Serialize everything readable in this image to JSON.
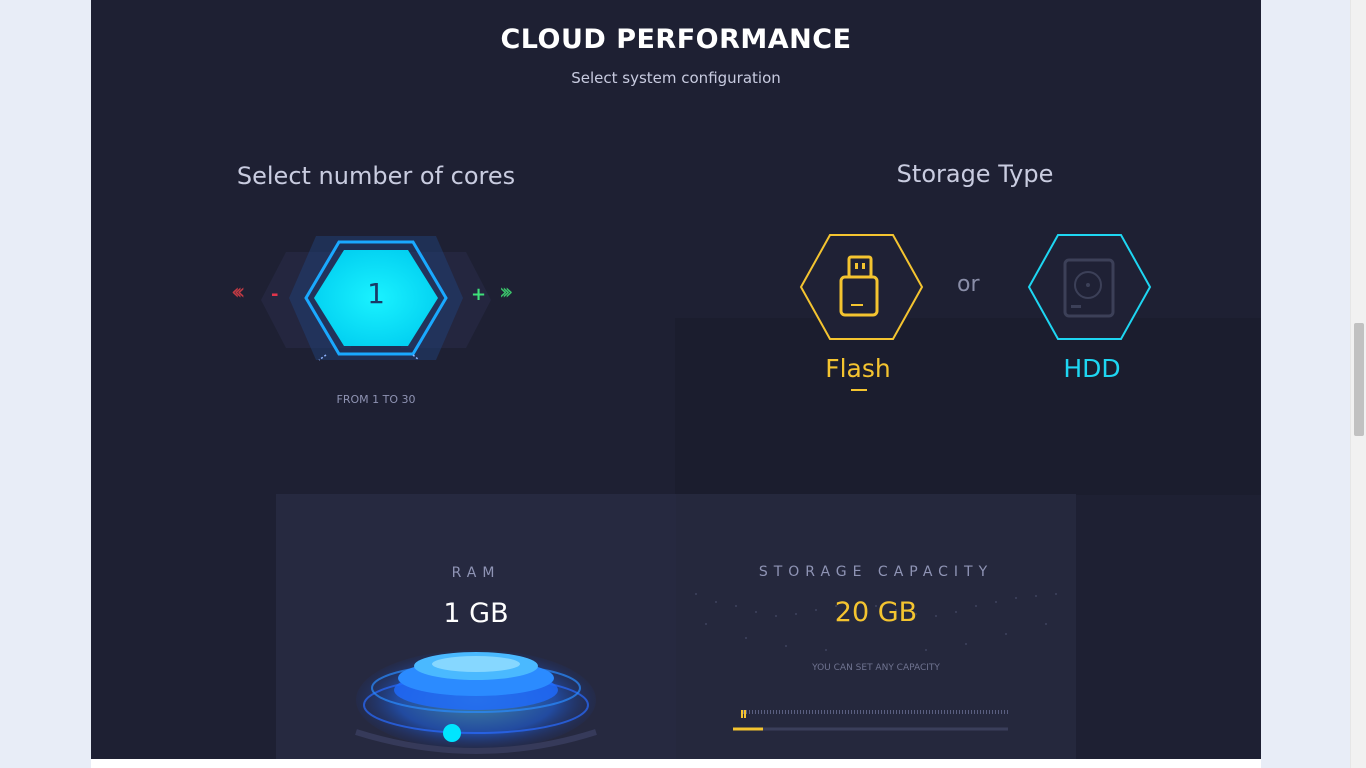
{
  "header": {
    "title": "CLOUD PERFORMANCE",
    "subtitle": "Select system configuration"
  },
  "cores": {
    "title": "Select number of cores",
    "minus_label": "-",
    "plus_label": "+",
    "value": "1",
    "range_text": "FROM 1 TO 30"
  },
  "storage_type": {
    "title": "Storage Type",
    "or_label": "or",
    "options": [
      {
        "label": "Flash",
        "selected": true,
        "color": "#f4c430",
        "icon": "usb-flash-icon"
      },
      {
        "label": "HDD",
        "selected": false,
        "color": "#1ed6f2",
        "icon": "hard-drive-icon"
      }
    ]
  },
  "ram": {
    "caption": "RAM",
    "value": "1 GB"
  },
  "storage_capacity": {
    "caption": "STORAGE CAPACITY",
    "value": "20 GB",
    "hint": "YOU CAN SET ANY CAPACITY"
  },
  "colors": {
    "panel_bg": "#1e2033",
    "accent_cyan": "#00e5ff",
    "accent_yellow": "#f4c430",
    "minus_red": "#e0344b",
    "plus_green": "#3ee07a"
  }
}
